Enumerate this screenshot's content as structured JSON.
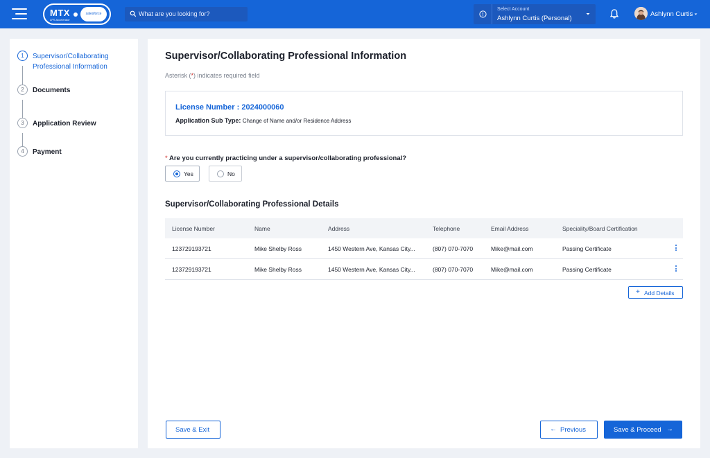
{
  "header": {
    "logo": {
      "text": "MTX",
      "sub": "LPS Accelerator",
      "partner": "salesforce"
    },
    "search": {
      "placeholder": "What are you looking for?"
    },
    "account": {
      "label": "Select Account",
      "value": "Ashlynn Curtis (Personal)"
    },
    "user": {
      "name": "Ashlynn Curtis"
    },
    "colors": {
      "bar": "#1565d8"
    }
  },
  "sidebar": {
    "steps": [
      {
        "number": "1",
        "label_line1": "Supervisor/Collaborating",
        "label_line2": "Professional Information",
        "active": true
      },
      {
        "number": "2",
        "label": "Documents"
      },
      {
        "number": "3",
        "label": "Application Review"
      },
      {
        "number": "4",
        "label": "Payment"
      }
    ]
  },
  "main": {
    "title": "Supervisor/Collaborating Professional Information",
    "required_note": {
      "prefix": "Asterisk (",
      "star": "*",
      "suffix": ") indicates required field"
    },
    "license": {
      "number": "License Number : 2024000060",
      "subtype_label": "Application Sub Type:",
      "subtype_value": "Change of Name and/or Residence Address"
    },
    "question": {
      "star": "*",
      "text": "Are you currently practicing under a supervisor/collaborating professional?",
      "options": [
        {
          "label": "Yes",
          "selected": true
        },
        {
          "label": "No",
          "selected": false
        }
      ]
    },
    "details": {
      "title": "Supervisor/Collaborating Professional Details",
      "columns": [
        "License Number",
        "Name",
        "Address",
        "Telephone",
        "Email Address",
        "Speciality/Board Certification"
      ],
      "rows": [
        [
          "123729193721",
          "Mike Shelby Ross",
          "1450 Western Ave, Kansas City...",
          "(807) 070-7070",
          "Mike@mail.com",
          "Passing Certificate"
        ],
        [
          "123729193721",
          "Mike Shelby Ross",
          "1450 Western Ave, Kansas City...",
          "(807) 070-7070",
          "Mike@mail.com",
          "Passing Certificate"
        ]
      ],
      "add_label": "Add Details"
    },
    "footer": {
      "save_exit": "Save & Exit",
      "previous": "Previous",
      "proceed": "Save & Proceed"
    }
  }
}
